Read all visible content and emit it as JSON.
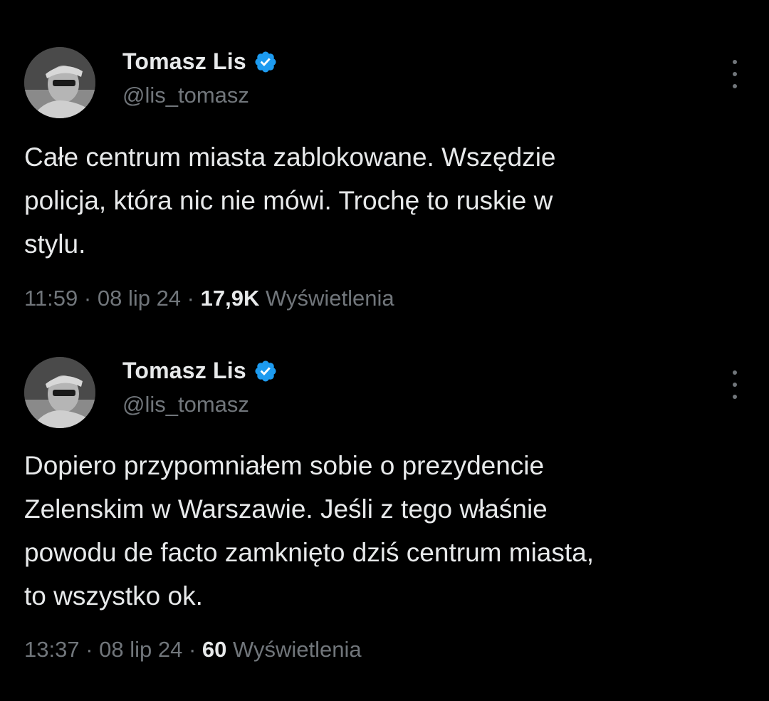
{
  "colors": {
    "background": "#000000",
    "primary_text": "#e7e9ea",
    "secondary_text": "#71767b",
    "verified_badge": "#1d9bf0"
  },
  "tweets": [
    {
      "author": {
        "name": "Tomasz Lis",
        "handle": "@lis_tomasz",
        "verified_icon": "verified-badge-icon"
      },
      "text": "Całe centrum miasta zablokowane. Wszędzie\npolicja, która nic nie mówi. Trochę to ruskie w\nstylu.",
      "time": "11:59",
      "sep1": " · ",
      "date": "08 lip 24",
      "sep2": " · ",
      "views_count": "17,9K",
      "views_label": " Wyświetlenia"
    },
    {
      "author": {
        "name": "Tomasz Lis",
        "handle": "@lis_tomasz",
        "verified_icon": "verified-badge-icon"
      },
      "text": "Dopiero przypomniałem sobie o prezydencie\nZelenskim w Warszawie. Jeśli z tego właśnie\npowodu de facto zamknięto dziś centrum miasta,\nto wszystko ok.",
      "time": "13:37",
      "sep1": " · ",
      "date": "08 lip 24",
      "sep2": " · ",
      "views_count": "60",
      "views_label": " Wyświetlenia"
    }
  ]
}
